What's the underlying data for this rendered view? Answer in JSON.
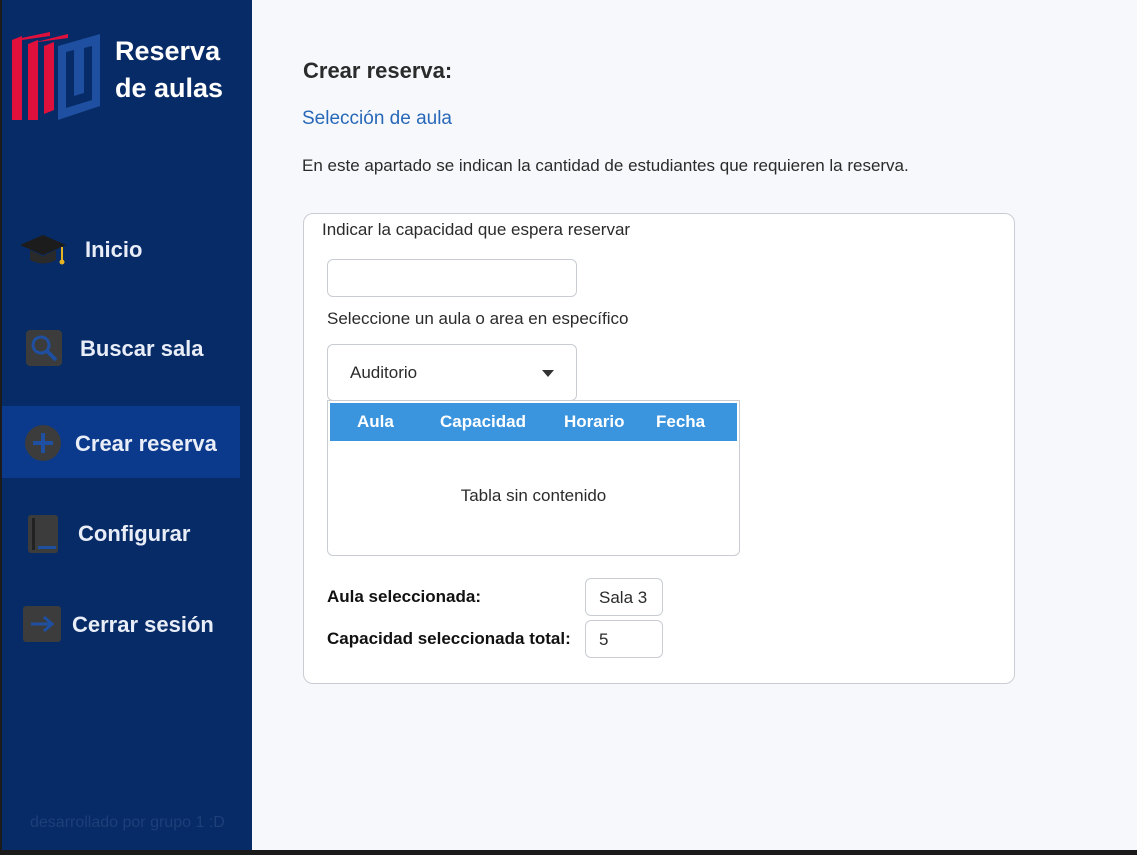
{
  "app": {
    "title_line1": "Reserva",
    "title_line2": "de aulas",
    "footer": "desarrollado por grupo 1 :D"
  },
  "sidebar": {
    "items": [
      {
        "label": "Inicio",
        "icon": "graduation-cap-icon",
        "active": false
      },
      {
        "label": "Buscar sala",
        "icon": "search-icon",
        "active": false
      },
      {
        "label": "Crear reserva",
        "icon": "plus-circle-icon",
        "active": true
      },
      {
        "label": "Configurar",
        "icon": "book-icon",
        "active": false
      },
      {
        "label": "Cerrar sesión",
        "icon": "logout-arrow-icon",
        "active": false
      }
    ]
  },
  "main": {
    "title": "Crear reserva:",
    "section_link": "Selección de aula",
    "description": "En este apartado se indican la cantidad de estudiantes que requieren la reserva.",
    "capacity_label": "Indicar la capacidad que espera reservar",
    "capacity_value": "",
    "select_label": "Seleccione un aula o area en específico",
    "select_value": "Auditorio",
    "table": {
      "columns": [
        "Aula",
        "Capacidad",
        "Horario",
        "Fecha"
      ],
      "empty_text": "Tabla sin contenido"
    },
    "summary": {
      "room_label": "Aula seleccionada:",
      "room_value": "Sala 3",
      "capacity_label": "Capacidad seleccionada total:",
      "capacity_value": "5"
    }
  },
  "colors": {
    "sidebar_bg": "#072b66",
    "sidebar_active": "#0b3a8d",
    "table_header": "#3a94de",
    "link": "#2868b8",
    "logo_red": "#e0103c",
    "logo_blue": "#1f4fa0"
  }
}
